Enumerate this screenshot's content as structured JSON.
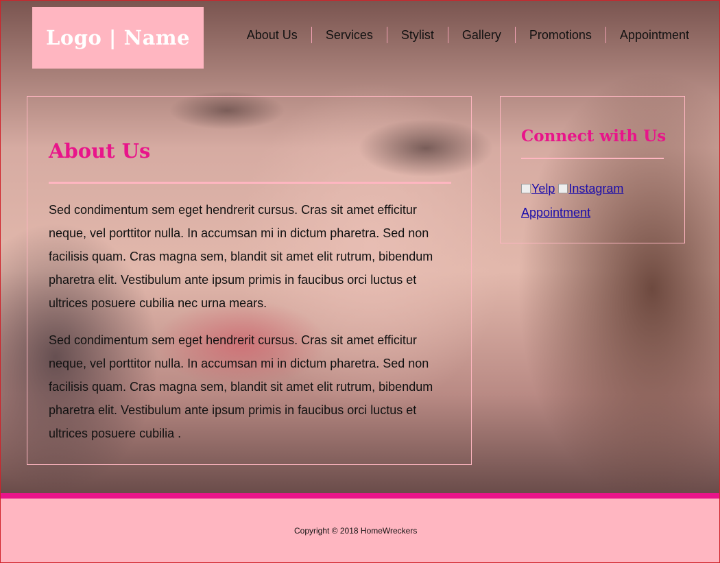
{
  "header": {
    "logo_text": "Logo | Name",
    "nav": [
      {
        "label": "About Us"
      },
      {
        "label": "Services"
      },
      {
        "label": "Stylist"
      },
      {
        "label": "Gallery"
      },
      {
        "label": "Promotions"
      },
      {
        "label": "Appointment"
      }
    ]
  },
  "about": {
    "title": "About Us",
    "paragraphs": [
      "Sed condimentum sem eget hendrerit cursus. Cras sit amet efficitur neque, vel porttitor nulla. In accumsan mi in dictum pharetra. Sed non facilisis quam. Cras magna sem, blandit sit amet elit rutrum, bibendum pharetra elit. Vestibulum ante ipsum primis in faucibus orci luctus et ultrices posuere cubilia nec urna mears.",
      "Sed condimentum sem eget hendrerit cursus. Cras sit amet efficitur neque, vel porttitor nulla. In accumsan mi in dictum pharetra. Sed non facilisis quam. Cras magna sem, blandit sit amet elit rutrum, bibendum pharetra elit. Vestibulum ante ipsum primis in faucibus orci luctus et ultrices posuere cubilia ."
    ]
  },
  "connect": {
    "title": "Connect with Us",
    "yelp_alt": "Yelp",
    "instagram_alt": "Instagram",
    "appointment_link": "Appointment"
  },
  "footer": {
    "copyright": "Copyright © 2018 HomeWreckers"
  },
  "colors": {
    "accent": "#e8158a",
    "pink": "#ffb6c1",
    "link": "#1a0dab"
  }
}
